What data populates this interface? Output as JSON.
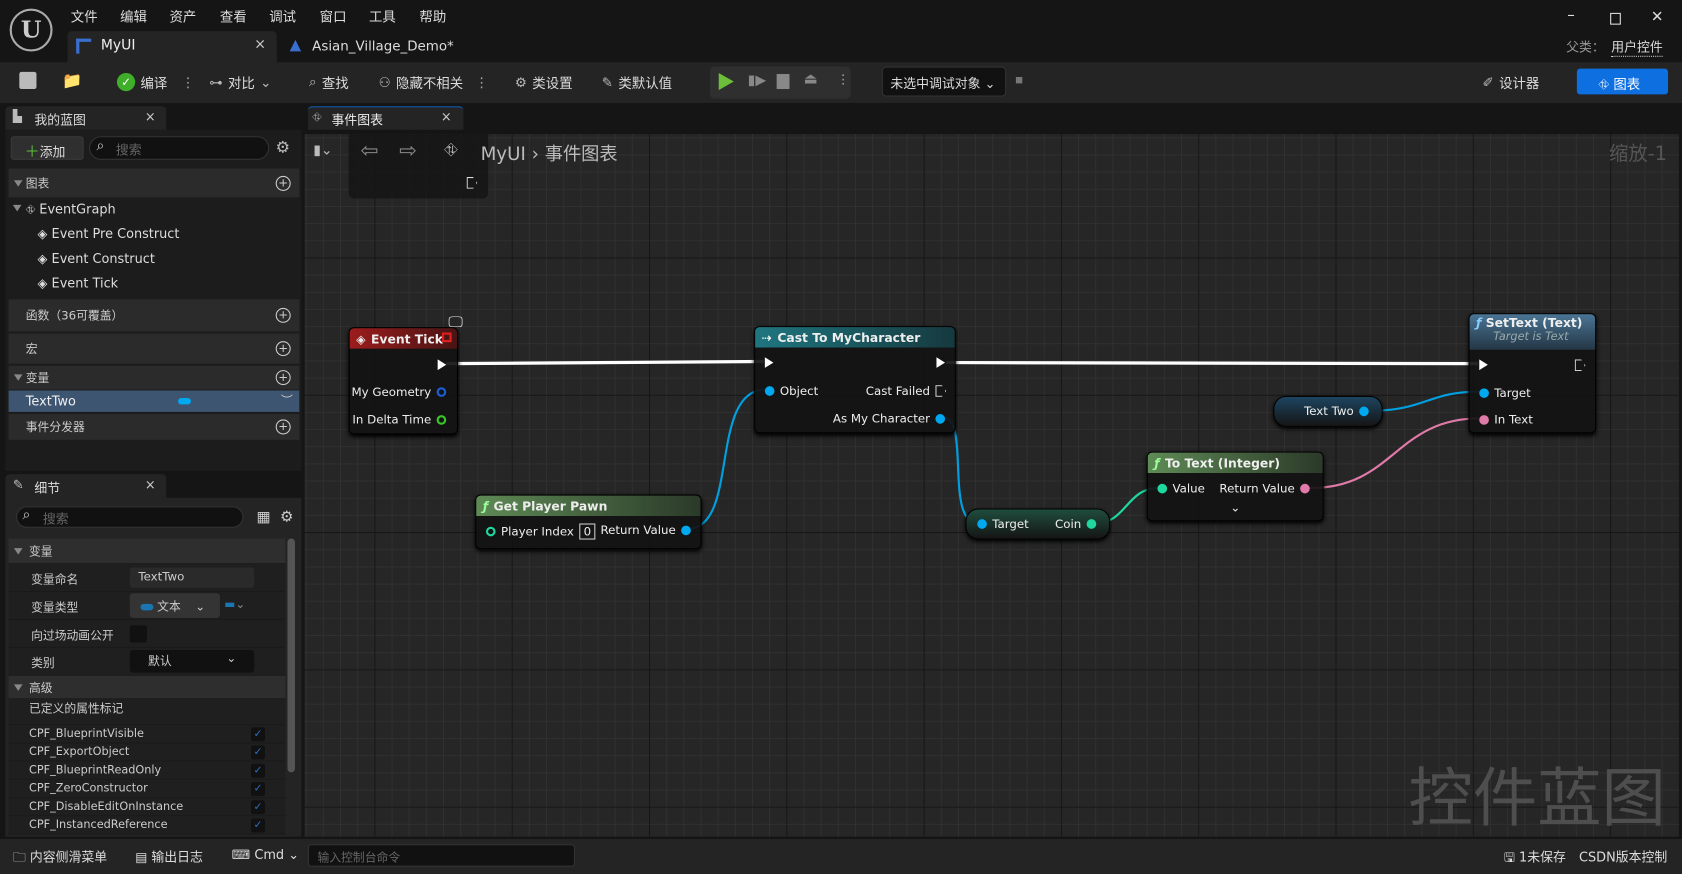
{
  "menu": [
    "文件",
    "编辑",
    "资产",
    "查看",
    "调试",
    "窗口",
    "工具",
    "帮助"
  ],
  "tabs": [
    {
      "label": "MyUI",
      "close": "×"
    },
    {
      "label": "Asian_Village_Demo*"
    }
  ],
  "parent_class": {
    "label": "父类：",
    "value": "用户控件"
  },
  "toolbar": {
    "compile": "编译",
    "diff": "对比",
    "find": "查找",
    "hide_unrelated": "隐藏不相关",
    "class_settings": "类设置",
    "class_defaults": "类默认值",
    "debug_target": "未选中调试对象",
    "designer": "设计器",
    "graph": "图表"
  },
  "my_blueprint": {
    "tab": "我的蓝图",
    "add": "添加",
    "search_placeholder": "搜索",
    "sections": {
      "graphs": "图表",
      "functions": "函数（36可覆盖）",
      "macros": "宏",
      "variables": "变量",
      "dispatchers": "事件分发器"
    },
    "event_graph": "EventGraph",
    "events": [
      "Event Pre Construct",
      "Event Construct",
      "Event Tick"
    ],
    "variable": "TextTwo"
  },
  "details": {
    "tab": "细节",
    "search_placeholder": "搜索",
    "section_variable": "变量",
    "rows": [
      {
        "label": "变量命名",
        "value": "TextTwo"
      },
      {
        "label": "变量类型",
        "value": "文本"
      },
      {
        "label": "向过场动画公开"
      },
      {
        "label": "类别",
        "value": "默认"
      }
    ],
    "section_advanced": "高级",
    "flags_label": "已定义的属性标记",
    "flags": [
      "CPF_BlueprintVisible",
      "CPF_ExportObject",
      "CPF_BlueprintReadOnly",
      "CPF_ZeroConstructor",
      "CPF_DisableEditOnInstance",
      "CPF_InstancedReference"
    ]
  },
  "graph": {
    "tab": "事件图表",
    "breadcrumb": [
      "MyUI",
      "事件图表"
    ],
    "zoom": "缩放-1",
    "watermark": "控件蓝图",
    "nodes": {
      "event_tick": {
        "title": "Event Tick",
        "pins": [
          "My Geometry",
          "In Delta Time"
        ]
      },
      "cast": {
        "title": "Cast To MyCharacter",
        "pins": [
          "Object",
          "Cast Failed",
          "As My Character"
        ]
      },
      "get_pawn": {
        "title": "Get Player Pawn",
        "pins": [
          "Player Index",
          "Return Value"
        ],
        "player_index": "0"
      },
      "coin": {
        "pins": [
          "Target",
          "Coin"
        ]
      },
      "to_text": {
        "title": "To Text (Integer)",
        "pins": [
          "Value",
          "Return Value"
        ]
      },
      "text_two": {
        "pins": [
          "Text Two"
        ]
      },
      "set_text": {
        "title": "SetText (Text)",
        "subtitle": "Target is Text",
        "pins": [
          "Target",
          "In Text"
        ]
      }
    }
  },
  "bottom": {
    "content_drawer": "内容侧滑菜单",
    "output_log": "输出日志",
    "cmd": "Cmd",
    "console_placeholder": "输入控制台命令",
    "unsaved": "1未保存",
    "source_control": "CSDN版本控制"
  },
  "colors": {
    "accent": "#0e6fe0",
    "exec": "#ffffff",
    "object": "#00a8f0",
    "text": "#e07aa8",
    "int": "#1fd8a0",
    "event_header": "#8b1a1a",
    "cast_header": "#1c6670",
    "func_pure": "#4a6b45",
    "func_target": "#3d5d78"
  }
}
